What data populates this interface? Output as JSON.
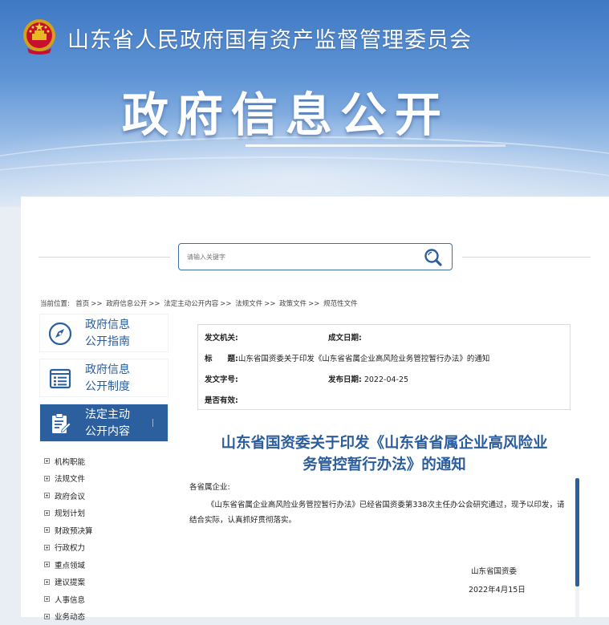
{
  "header": {
    "org_name": "山东省人民政府国有资产监督管理委员会",
    "section_title": "政府信息公开"
  },
  "search": {
    "placeholder": "请输入关键字"
  },
  "breadcrumb": {
    "label": "当前位置:",
    "items": [
      "首页",
      "政府信息公开",
      "法定主动公开内容",
      "法规文件",
      "政策文件",
      "规范性文件"
    ],
    "separator": ">>"
  },
  "sidebar": {
    "cards": [
      {
        "line1": "政府信息",
        "line2": "公开指南",
        "icon": "compass-icon"
      },
      {
        "line1": "政府信息",
        "line2": "公开制度",
        "icon": "list-icon"
      },
      {
        "line1": "法定主动",
        "line2": "公开内容",
        "icon": "document-edit-icon"
      }
    ],
    "items": [
      "机构职能",
      "法规文件",
      "政府会议",
      "规划计划",
      "财政预决算",
      "行政权力",
      "重点领域",
      "建议提案",
      "人事信息",
      "业务动态"
    ]
  },
  "info": {
    "issuer_label": "发文机关:",
    "issuer_value": "",
    "created_label": "成文日期:",
    "created_value": "",
    "title_label": "标　　题:",
    "title_value": "山东省国资委关于印发《山东省省属企业高风险业务管控暂行办法》的通知",
    "docno_label": "发文字号:",
    "docno_value": "",
    "published_label": "发布日期:",
    "published_value": "2022-04-25",
    "valid_label": "是否有效:",
    "valid_value": ""
  },
  "document": {
    "title_line1": "山东省国资委关于印发《山东省省属企业高风险业",
    "title_line2": "务管控暂行办法》的通知",
    "salutation": "各省属企业:",
    "body": "《山东省省属企业高风险业务管控暂行办法》已经省国资委第338次主任办公会研究通过，现予以印发，请结合实际，认真抓好贯彻落实。",
    "signature": "山东省国资委",
    "date": "2022年4月15日"
  },
  "colors": {
    "brand_blue": "#2c5f9e",
    "title_blue": "#2b5d9c"
  }
}
